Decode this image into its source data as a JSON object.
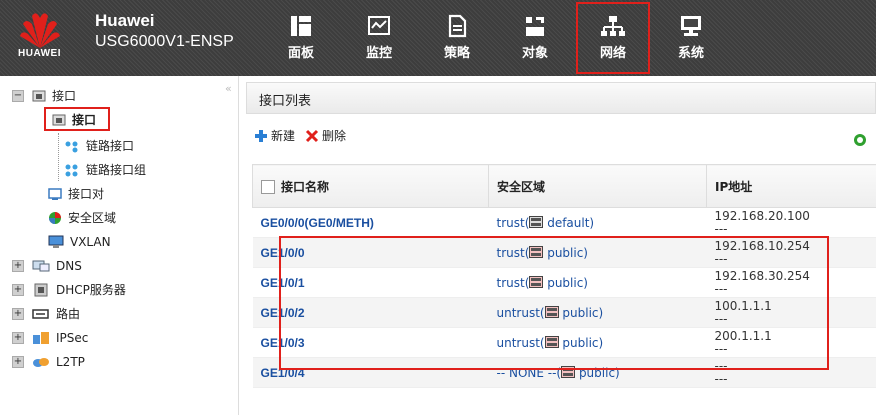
{
  "header": {
    "logo_text": "HUAWEI",
    "brand_line1": "Huawei",
    "brand_line2": "USG6000V1-ENSP",
    "nav": [
      {
        "label": "面板",
        "icon": "dashboard-icon"
      },
      {
        "label": "监控",
        "icon": "monitor-icon"
      },
      {
        "label": "策略",
        "icon": "policy-icon"
      },
      {
        "label": "对象",
        "icon": "object-icon"
      },
      {
        "label": "网络",
        "icon": "network-icon",
        "active": true
      },
      {
        "label": "系统",
        "icon": "system-icon"
      }
    ]
  },
  "sidebar": {
    "items": [
      {
        "label": "接口"
      },
      {
        "label": "接口"
      },
      {
        "label": "链路接口"
      },
      {
        "label": "链路接口组"
      },
      {
        "label": "接口对"
      },
      {
        "label": "安全区域"
      },
      {
        "label": "VXLAN"
      },
      {
        "label": "DNS"
      },
      {
        "label": "DHCP服务器"
      },
      {
        "label": "路由"
      },
      {
        "label": "IPSec"
      },
      {
        "label": "L2TP"
      }
    ]
  },
  "main": {
    "title": "接口列表",
    "toolbar": {
      "new_label": "新建",
      "delete_label": "删除"
    },
    "columns": [
      "接口名称",
      "安全区域",
      "IP地址"
    ],
    "rows": [
      {
        "name": "GE0/0/0(GE0/METH)",
        "zone": "trust(",
        "vsys": " default)",
        "ip": "192.168.20.100",
        "ip2": "---"
      },
      {
        "name": "GE1/0/0",
        "zone": "trust(",
        "vsys": " public)",
        "ip": "192.168.10.254",
        "ip2": "---"
      },
      {
        "name": "GE1/0/1",
        "zone": "trust(",
        "vsys": " public)",
        "ip": "192.168.30.254",
        "ip2": "---"
      },
      {
        "name": "GE1/0/2",
        "zone": "untrust(",
        "vsys": " public)",
        "ip": "100.1.1.1",
        "ip2": "---"
      },
      {
        "name": "GE1/0/3",
        "zone": "untrust(",
        "vsys": " public)",
        "ip": "200.1.1.1",
        "ip2": "---"
      },
      {
        "name": "GE1/0/4",
        "zone": "-- NONE --(",
        "vsys": " public)",
        "ip": "---",
        "ip2": "---"
      }
    ]
  },
  "colors": {
    "accent_red": "#e0201b",
    "link_blue": "#1a4fa0",
    "header_bg": "#444444"
  }
}
